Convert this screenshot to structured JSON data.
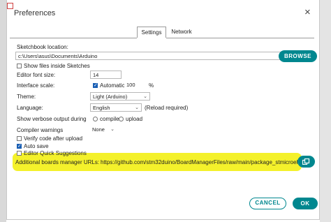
{
  "window": {
    "title": "Preferences",
    "close_glyph": "×"
  },
  "tabs": [
    {
      "label": "Settings",
      "active": true
    },
    {
      "label": "Network",
      "active": false
    }
  ],
  "sketchbook": {
    "label": "Sketchbook location:",
    "value": "c:\\Users\\asus\\Documents\\Arduino",
    "browse_label": "BROWSE",
    "show_files_label": "Show files inside Sketches",
    "show_files_checked": false
  },
  "editor_font": {
    "label": "Editor font size:",
    "value": "14"
  },
  "interface_scale": {
    "label": "Interface scale:",
    "automatic_label": "Automatic",
    "automatic_checked": true,
    "value": "100",
    "unit": "%"
  },
  "theme": {
    "label": "Theme:",
    "value": "Light (Arduino)"
  },
  "language": {
    "label": "Language:",
    "value": "English",
    "note": "(Reload required)"
  },
  "verbose": {
    "label": "Show verbose output during",
    "compile_label": "compile",
    "upload_label": "upload"
  },
  "compiler_warnings": {
    "label": "Compiler warnings",
    "value": "None"
  },
  "options": [
    {
      "label": "Verify code after upload",
      "checked": false
    },
    {
      "label": "Auto save",
      "checked": true
    },
    {
      "label": "Editor Quick Suggestions",
      "checked": false
    }
  ],
  "boards_manager": {
    "label": "Additional boards manager URLs:",
    "value": "https://github.com/stm32duino/BoardManagerFiles/raw/main/package_stmicroele"
  },
  "footer": {
    "cancel_label": "CANCEL",
    "ok_label": "OK"
  },
  "colors": {
    "accent": "#00878f",
    "highlight": "#f3f020",
    "checkbox": "#1a5fb4"
  },
  "icons": {
    "window_icon": "windows-icon",
    "close": "close-icon",
    "open_window": "open-window-icon"
  }
}
